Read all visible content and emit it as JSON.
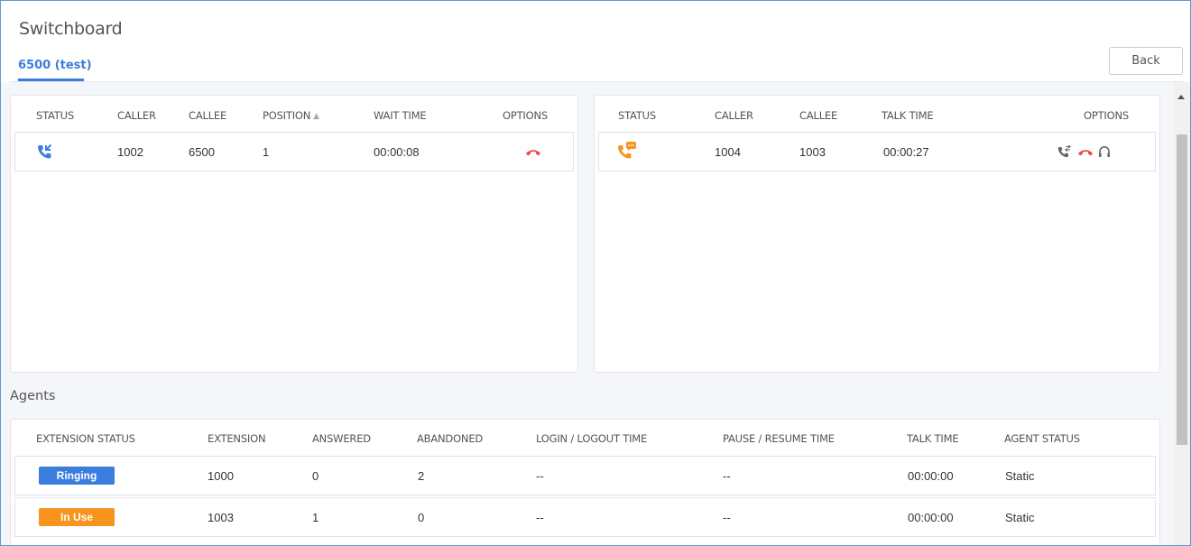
{
  "header": {
    "title": "Switchboard",
    "tab_label": "6500 (test)",
    "back_label": "Back"
  },
  "queue": {
    "columns": [
      "STATUS",
      "CALLER",
      "CALLEE",
      "POSITION",
      "WAIT TIME",
      "OPTIONS"
    ],
    "rows": [
      {
        "status_icon": "phone-incoming-icon",
        "caller": "1002",
        "callee": "6500",
        "position": "1",
        "wait_time": "00:00:08",
        "options": [
          "hangup-icon"
        ]
      }
    ]
  },
  "active": {
    "columns": [
      "STATUS",
      "CALLER",
      "CALLEE",
      "TALK TIME",
      "OPTIONS"
    ],
    "rows": [
      {
        "status_icon": "phone-talking-icon",
        "caller": "1004",
        "callee": "1003",
        "talk_time": "00:00:27",
        "options": [
          "transfer-icon",
          "hangup-icon",
          "listen-headset-icon"
        ]
      }
    ]
  },
  "agents": {
    "title": "Agents",
    "columns": [
      "EXTENSION STATUS",
      "EXTENSION",
      "ANSWERED",
      "ABANDONED",
      "LOGIN / LOGOUT TIME",
      "PAUSE / RESUME TIME",
      "TALK TIME",
      "AGENT STATUS"
    ],
    "rows": [
      {
        "status": "Ringing",
        "status_color": "#3b7ddd",
        "extension": "1000",
        "answered": "0",
        "abandoned": "2",
        "login_logout": "--",
        "pause_resume": "--",
        "talk_time": "00:00:00",
        "agent_status": "Static"
      },
      {
        "status": "In Use",
        "status_color": "#f7941d",
        "extension": "1003",
        "answered": "1",
        "abandoned": "0",
        "login_logout": "--",
        "pause_resume": "--",
        "talk_time": "00:00:00",
        "agent_status": "Static"
      }
    ]
  },
  "colors": {
    "accent": "#3b7ddd",
    "hangup": "#e84a4a",
    "talking": "#f7941d"
  }
}
